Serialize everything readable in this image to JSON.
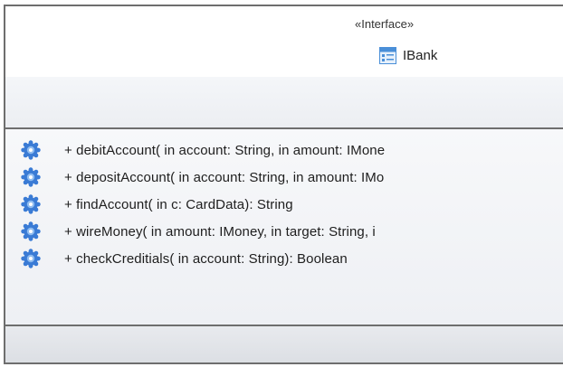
{
  "interface": {
    "stereotype": "«Interface»",
    "name": "IBank",
    "icon": "interface-icon"
  },
  "operations": [
    {
      "icon": "operation-gear-icon",
      "text": "+ debitAccount(  in account: String,   in amount: IMone"
    },
    {
      "icon": "operation-gear-icon",
      "text": "+ depositAccount(  in account: String,   in amount: IMo"
    },
    {
      "icon": "operation-gear-icon",
      "text": "+ findAccount(  in c: CardData): String"
    },
    {
      "icon": "operation-gear-icon",
      "text": "+ wireMoney(  in amount: IMoney,   in target: String,   i"
    },
    {
      "icon": "operation-gear-icon",
      "text": "+ checkCreditials(  in account: String): Boolean"
    }
  ],
  "colors": {
    "border": "#6e6e6e",
    "gear": "#3a7bd5",
    "icon_blue": "#4a8fd8"
  }
}
